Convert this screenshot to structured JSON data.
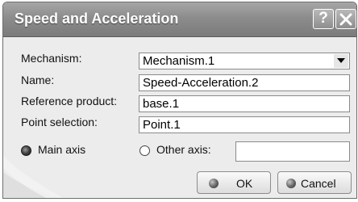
{
  "dialog": {
    "title": "Speed and Acceleration",
    "help_glyph": "?"
  },
  "form": {
    "mechanism": {
      "label": "Mechanism:",
      "value": "Mechanism.1"
    },
    "name": {
      "label": "Name:",
      "value": "Speed-Acceleration.2"
    },
    "reference_product": {
      "label": "Reference product:",
      "value": "base.1"
    },
    "point_selection": {
      "label": "Point selection:",
      "value": "Point.1"
    },
    "axis": {
      "main_axis_label": "Main axis",
      "other_axis_label": "Other axis:",
      "other_axis_value": "",
      "selected": "Main axis"
    }
  },
  "buttons": {
    "ok": "OK",
    "cancel": "Cancel"
  }
}
